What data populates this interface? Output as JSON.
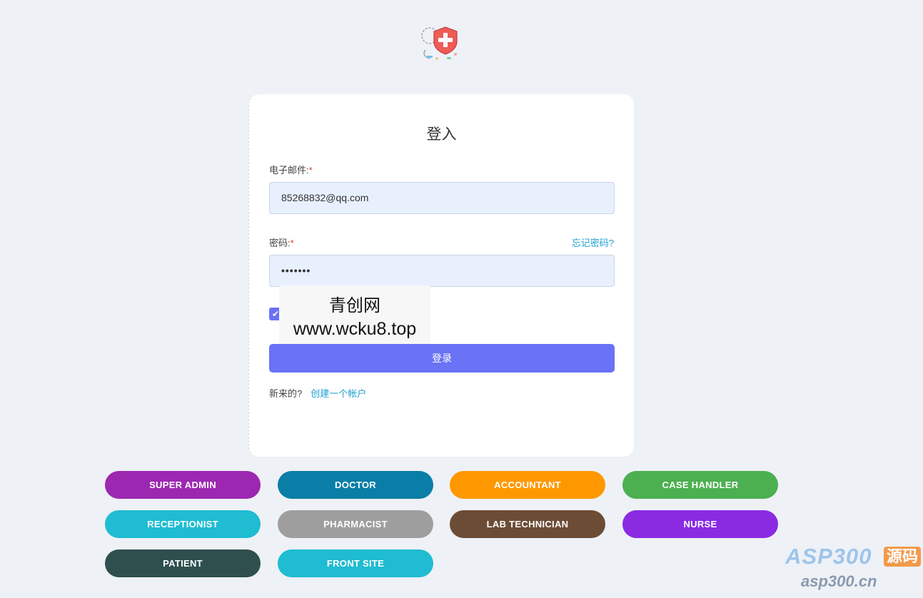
{
  "login": {
    "title": "登入",
    "email_label": "电子邮件:",
    "email_value": "85268832@qq.com",
    "password_label": "密码:",
    "required_mark": "*",
    "forgot_label": "忘记密码?",
    "password_value": "•••••••",
    "remember_check": "✔",
    "submit_label": "登录",
    "new_text": "新来的?",
    "signup_link": "创建一个帐户"
  },
  "watermark": {
    "line1": "青创网",
    "line2": "www.wcku8.top"
  },
  "roles": [
    {
      "label": "SUPER ADMIN",
      "color": "#9c27b0"
    },
    {
      "label": "DOCTOR",
      "color": "#0a7ea6"
    },
    {
      "label": "ACCOUNTANT",
      "color": "#ff9800"
    },
    {
      "label": "CASE HANDLER",
      "color": "#4caf50"
    },
    {
      "label": "RECEPTIONIST",
      "color": "#1fbcd2"
    },
    {
      "label": "PHARMACIST",
      "color": "#9e9e9e"
    },
    {
      "label": "LAB TECHNICIAN",
      "color": "#6d4c36"
    },
    {
      "label": "NURSE",
      "color": "#8a2be2"
    },
    {
      "label": "PATIENT",
      "color": "#2f4f4f"
    },
    {
      "label": "FRONT SITE",
      "color": "#1fbcd2"
    }
  ],
  "branding": {
    "main": "ASP300",
    "tag": "源码",
    "url": "asp300.cn"
  }
}
